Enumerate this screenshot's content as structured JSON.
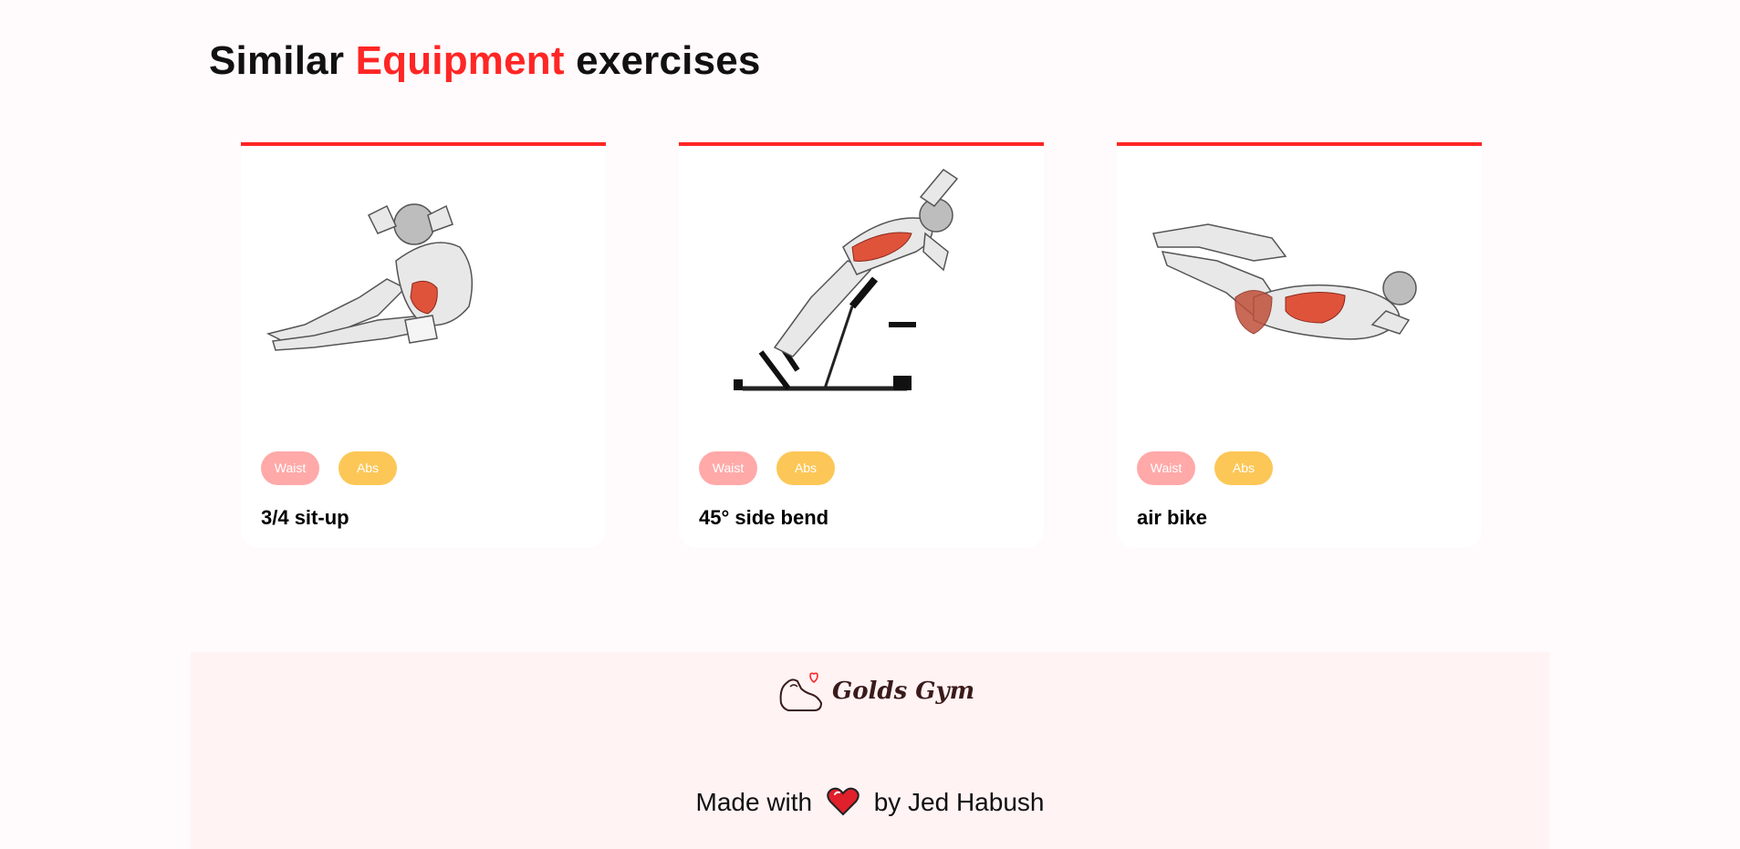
{
  "heading": {
    "prefix": "Similar",
    "accent": "Equipment",
    "suffix": "exercises"
  },
  "exercises": [
    {
      "name": "3/4 sit-up",
      "body_part": "Waist",
      "target": "Abs",
      "image": "sit-up-illustration"
    },
    {
      "name": "45° side bend",
      "body_part": "Waist",
      "target": "Abs",
      "image": "side-bend-illustration"
    },
    {
      "name": "air bike",
      "body_part": "Waist",
      "target": "Abs",
      "image": "air-bike-illustration"
    }
  ],
  "footer": {
    "logo_text": "Golds Gym",
    "made_with": "Made with",
    "by": "by Jed Habush"
  },
  "colors": {
    "accent": "#ff2625",
    "body_tag": "#ffa9a9",
    "target_tag": "#fcc757",
    "page_bg": "#fffafb",
    "footer_bg": "#fff3f4"
  }
}
